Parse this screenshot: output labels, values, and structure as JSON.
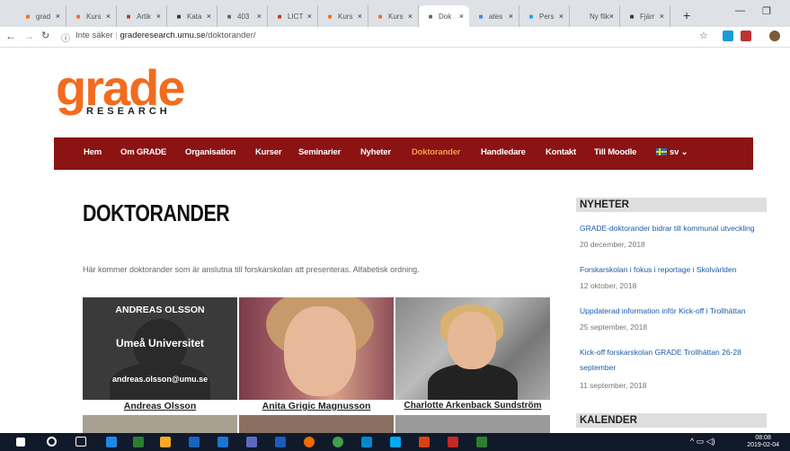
{
  "browser": {
    "tabs": [
      {
        "label": "grad",
        "icon": "fb-icon",
        "color": "#f26b1f"
      },
      {
        "label": "Kurs",
        "icon": "fb-icon",
        "color": "#f26b1f"
      },
      {
        "label": "Artik",
        "icon": "opera-icon",
        "color": "#c0392b"
      },
      {
        "label": "Kata",
        "icon": "umu-icon",
        "color": "#333333"
      },
      {
        "label": "403",
        "icon": "page-icon",
        "color": "#666666"
      },
      {
        "label": "LICT",
        "icon": "opera-icon",
        "color": "#c0392b"
      },
      {
        "label": "Kurs",
        "icon": "fb-icon",
        "color": "#f26b1f"
      },
      {
        "label": "Kurs",
        "icon": "fb-icon",
        "color": "#f26b1f"
      },
      {
        "label": "Dok",
        "icon": "page-icon",
        "color": "#666666"
      },
      {
        "label": "ates",
        "icon": "google-icon",
        "color": "#4285f4"
      },
      {
        "label": "Pers",
        "icon": "twitter-icon",
        "color": "#1da1f2"
      },
      {
        "label": "Ny flik",
        "icon": "",
        "color": "#666666"
      },
      {
        "label": "Fjärr",
        "icon": "umu-icon",
        "color": "#333333"
      }
    ],
    "active_tab": 8,
    "security_label": "Inte säker",
    "url_host": "graderesearch.umu.se",
    "url_path": "/doktorander/"
  },
  "site": {
    "logo_main": "grade",
    "logo_sub": "RESEARCH",
    "menu": [
      "Hem",
      "Om GRADE",
      "Organisation",
      "Kurser",
      "Seminarier",
      "Nyheter",
      "Doktorander",
      "Handledare",
      "Kontakt",
      "Till Moodle"
    ],
    "menu_active": "Doktorander",
    "lang": "sv"
  },
  "main": {
    "title": "DOKTORANDER",
    "intro": "Här kommer doktorander som är anslutna till forskarskolan att presenteras. Alfabetisk ordning.",
    "cards": [
      {
        "name": "Andreas Olsson",
        "overlay_name": "ANDREAS OLSSON",
        "overlay_uni": "Umeå Universitet",
        "overlay_email": "andreas.olsson@umu.se"
      },
      {
        "name": "Anita Grigic Magnusson"
      },
      {
        "name": "Charlotte Arkenback Sundström"
      }
    ]
  },
  "sidebar": {
    "news_heading": "NYHETER",
    "news": [
      {
        "title": "GRADE-doktorander bidrar till kommunal utveckling",
        "date": "20 december, 2018"
      },
      {
        "title": "Forskarskolan i fokus i reportage i Skolvärlden",
        "date": "12 oktober, 2018"
      },
      {
        "title": "Uppdaterad information inför Kick-off i Trollhättan",
        "date": "25 september, 2018"
      },
      {
        "title": "Kick-off forskarskolan GRADE Trollhättan 26-28 september",
        "date": "11 september, 2018"
      }
    ],
    "calendar_heading": "KALENDER"
  },
  "taskbar": {
    "time": "08:08",
    "date": "2019-02-04"
  }
}
